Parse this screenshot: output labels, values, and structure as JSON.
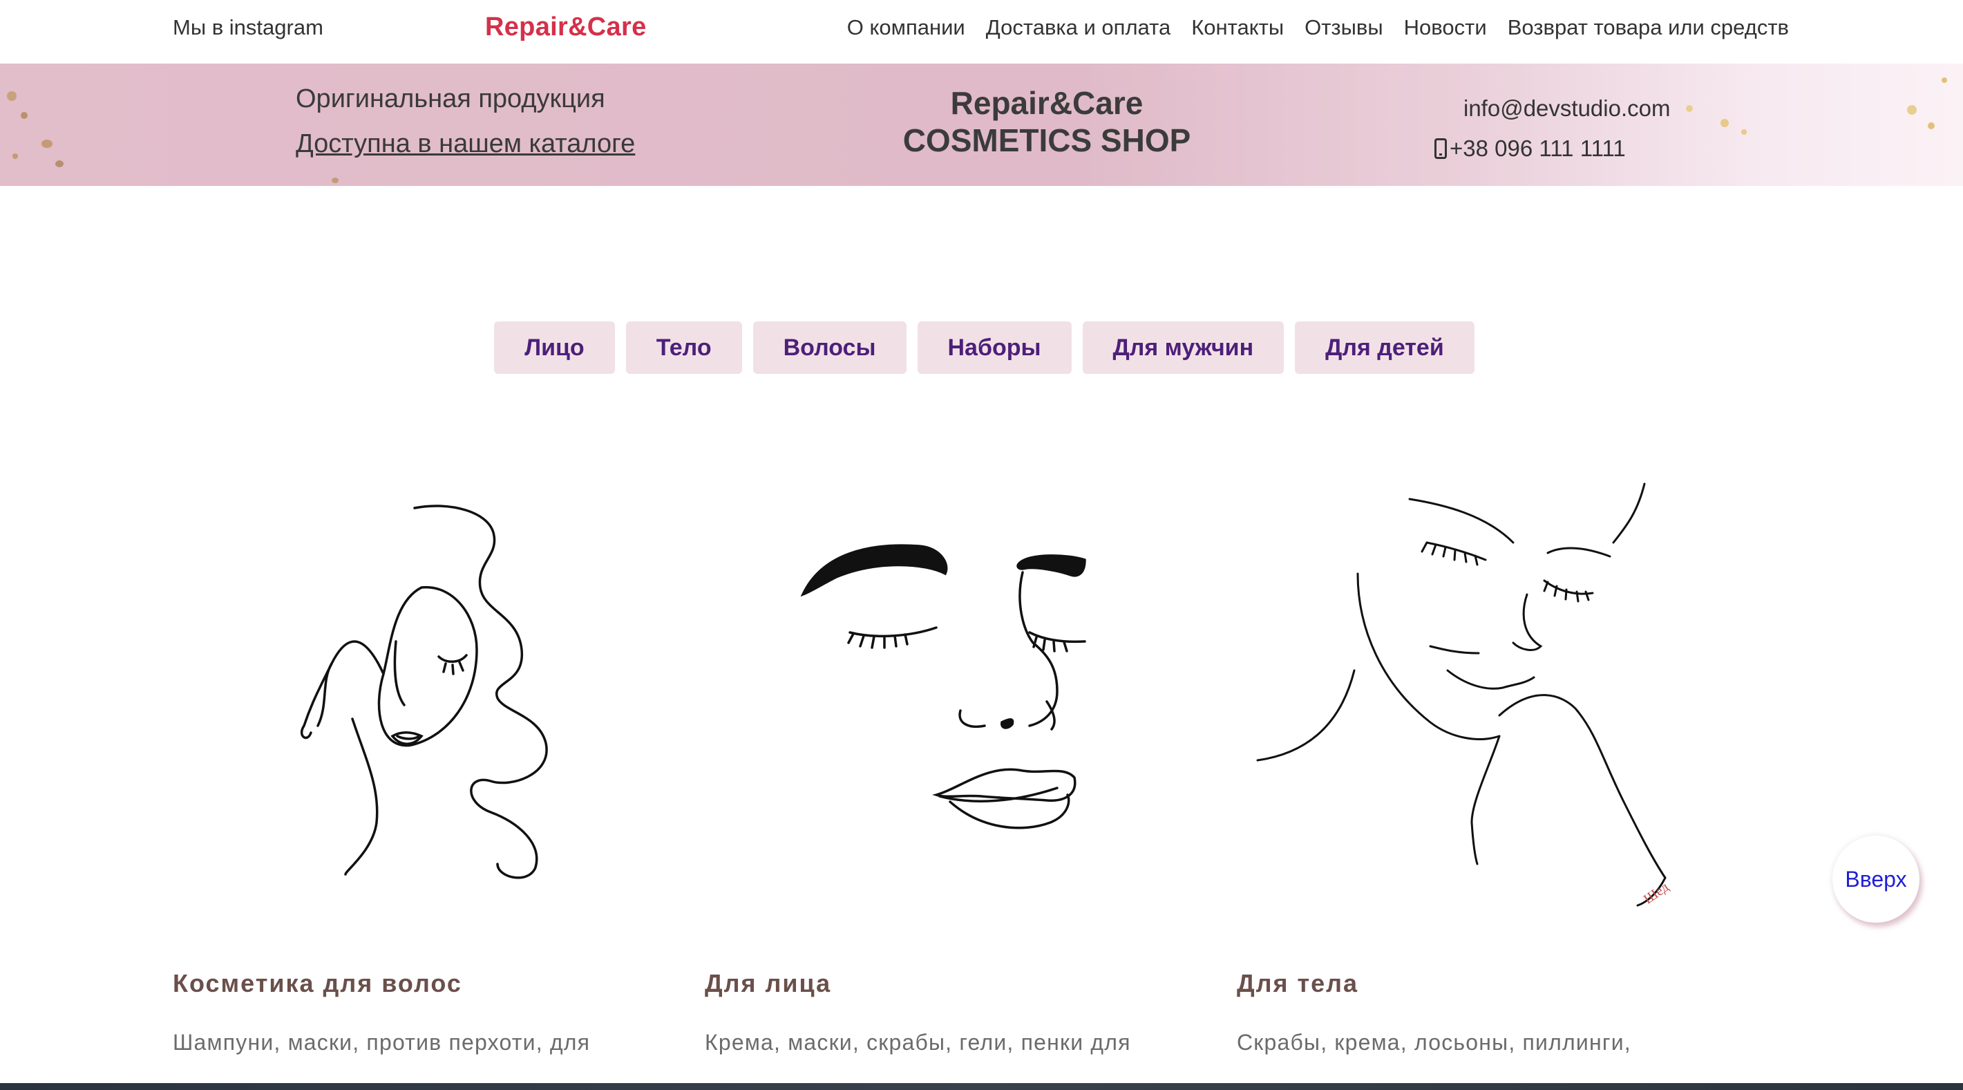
{
  "header": {
    "instagram": "Мы в instagram",
    "logo": "Repair&Care",
    "menu": [
      "О компании",
      "Доставка и оплата",
      "Контакты",
      "Отзывы",
      "Новости",
      "Возврат товара или средств"
    ]
  },
  "banner": {
    "original": "Оригинальная продукция",
    "catalog_link": "Доступна в нашем каталоге",
    "brand_line1": "Repair&Care",
    "brand_line2": "COSMETICS SHOP",
    "email": "info@devstudio.com",
    "phone": "+38 096 111 1111"
  },
  "categories": [
    "Лицо",
    "Тело",
    "Волосы",
    "Наборы",
    "Для мужчин",
    "Для детей"
  ],
  "columns": [
    {
      "title": "Косметика для волос",
      "text": "Шампуни, маски, против перхоти, для"
    },
    {
      "title": "Для лица",
      "text": "Крема, маски, скрабы, гели, пенки для"
    },
    {
      "title": "Для тела",
      "text": "Скрабы, крема, лосьоны, пиллинги,"
    }
  ],
  "up_button": "Вверх",
  "colors": {
    "logo": "#d5304a",
    "banner": "#e2bdca",
    "category_bg": "#f1e1e6",
    "category_text": "#4d1f7a",
    "column_title": "#6a4f4b",
    "up_text": "#1f1fd6"
  },
  "icons": [
    "phone-icon",
    "hair-woman-illustration",
    "face-illustration",
    "shoulder-woman-illustration"
  ]
}
